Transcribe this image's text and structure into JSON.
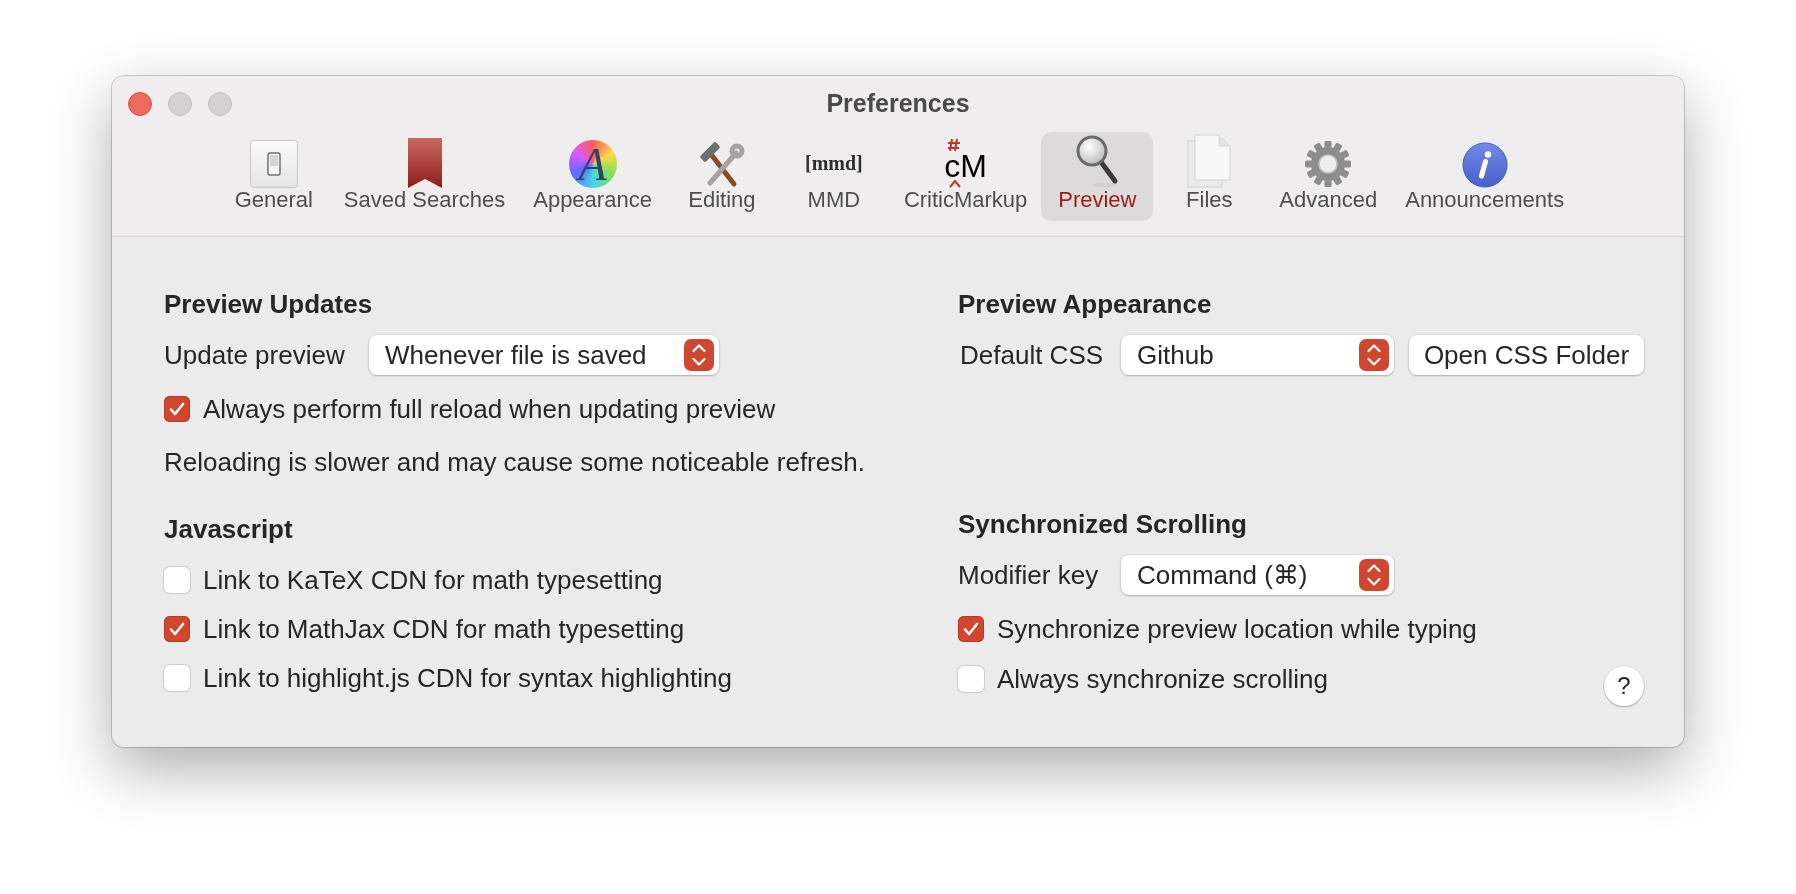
{
  "window": {
    "title": "Preferences",
    "buttons": [
      {
        "kind": "close",
        "disabled": false
      },
      {
        "kind": "minimize",
        "disabled": true
      },
      {
        "kind": "zoom",
        "disabled": true
      }
    ]
  },
  "toolbar": {
    "tabs": [
      {
        "label": "General",
        "selected": false
      },
      {
        "label": "Saved Searches",
        "selected": false
      },
      {
        "label": "Appearance",
        "selected": false,
        "icon_text": "A"
      },
      {
        "label": "Editing",
        "selected": false
      },
      {
        "label": "MMD",
        "selected": false,
        "icon_text": "[mmd]"
      },
      {
        "label": "CriticMarkup",
        "selected": false,
        "icon_text": "cM"
      },
      {
        "label": "Preview",
        "selected": true
      },
      {
        "label": "Files",
        "selected": false
      },
      {
        "label": "Advanced",
        "selected": false
      },
      {
        "label": "Announcements",
        "selected": false
      }
    ]
  },
  "preview_updates": {
    "heading": "Preview Updates",
    "update_preview": {
      "label": "Update preview",
      "value": "Whenever file is saved"
    },
    "full_reload": {
      "label": "Always perform full reload when updating preview",
      "checked": true
    },
    "note": "Reloading is slower and may cause some noticeable refresh."
  },
  "javascript": {
    "heading": "Javascript",
    "options": [
      {
        "label": "Link to KaTeX CDN for math typesetting",
        "checked": false
      },
      {
        "label": "Link to MathJax CDN for math typesetting",
        "checked": true
      },
      {
        "label": "Link to highlight.js CDN for syntax highlighting",
        "checked": false
      }
    ]
  },
  "preview_appearance": {
    "heading": "Preview Appearance",
    "default_css": {
      "label": "Default CSS",
      "value": "Github"
    },
    "open_folder_button": "Open CSS Folder"
  },
  "synchronized_scrolling": {
    "heading": "Synchronized Scrolling",
    "modifier_key": {
      "label": "Modifier key",
      "value": "Command (⌘)"
    },
    "options": [
      {
        "label": "Synchronize preview location while typing",
        "checked": true
      },
      {
        "label": "Always synchronize scrolling",
        "checked": false
      }
    ]
  },
  "help_button": "?"
}
